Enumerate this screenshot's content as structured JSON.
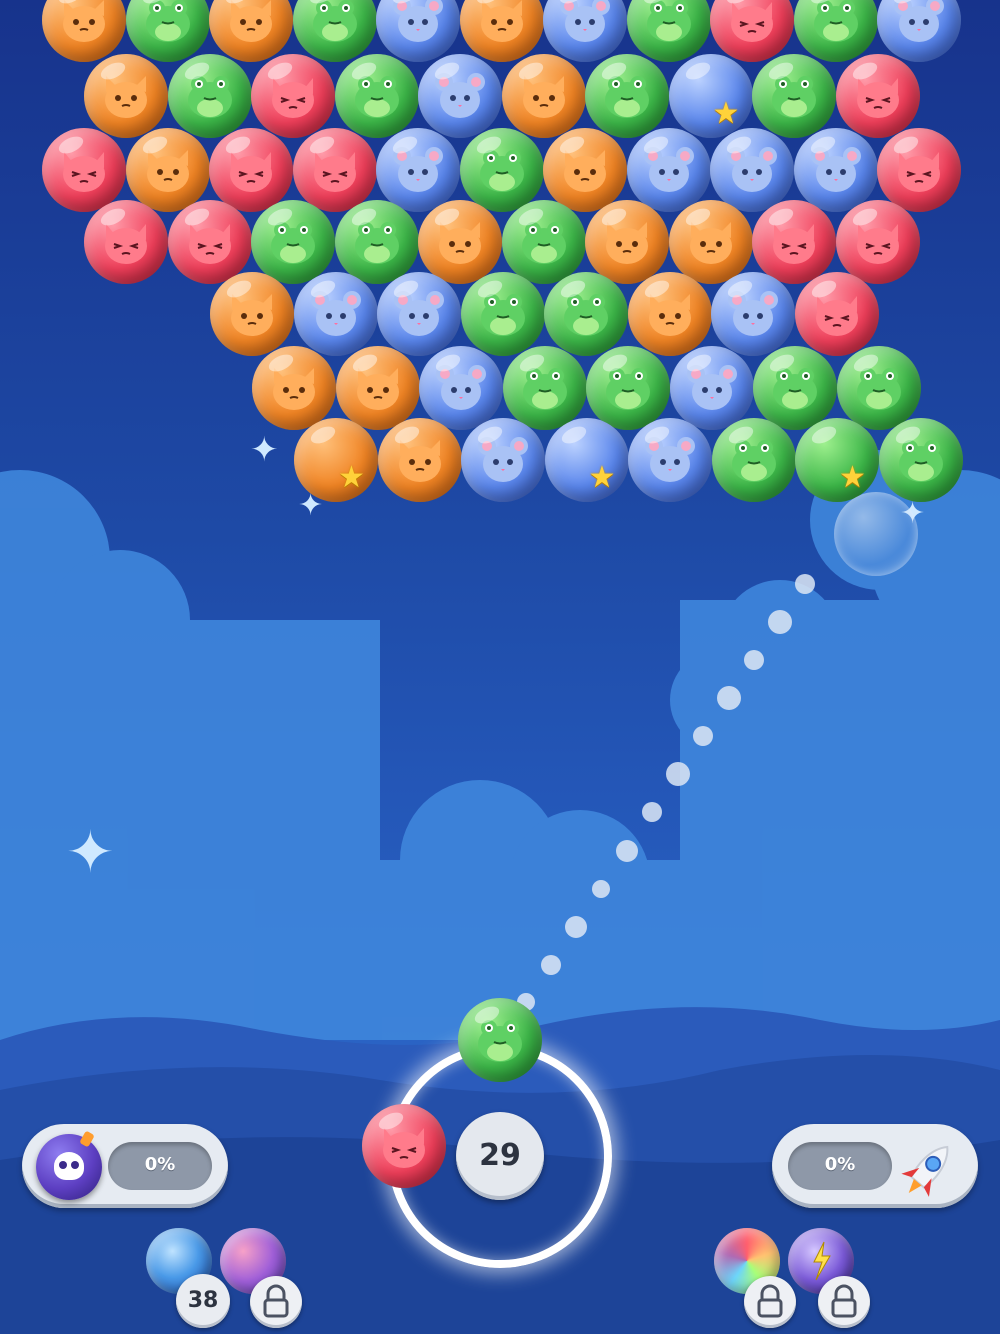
{
  "game": {
    "colors": {
      "orange": "#f4892a",
      "green": "#3cb648",
      "blue": "#5a86ec",
      "red": "#ef3f5a"
    },
    "grid": {
      "animals": {
        "orange": "cat",
        "green": "frog",
        "blue": "mouse",
        "red": "cat-red"
      },
      "rows": [
        [
          "orange",
          "green",
          "orange",
          "green",
          "blue",
          "orange",
          "blue",
          "green",
          "red",
          "green",
          "blue"
        ],
        [
          "orange",
          "green",
          "red",
          "green",
          "blue",
          "orange",
          "green",
          "blue-star",
          "green",
          "red"
        ],
        [
          "red",
          "orange",
          "red",
          "red",
          "blue",
          "green",
          "orange",
          "blue",
          "blue",
          "blue",
          "red"
        ],
        [
          "red",
          "red",
          "green",
          "green",
          "orange",
          "green",
          "orange",
          "orange",
          "red",
          "red"
        ],
        [
          "orange",
          "blue",
          "blue",
          "green",
          "green",
          "orange",
          "blue",
          "red"
        ],
        [
          "orange",
          "orange",
          "blue",
          "green",
          "green",
          "blue",
          "green",
          "green"
        ],
        [
          "orange-star",
          "orange",
          "blue",
          "blue-star",
          "blue",
          "green",
          "green-star",
          "green"
        ]
      ]
    },
    "shooter": {
      "current_bubble": "green",
      "next_bubble": "red",
      "shots_left": "29"
    },
    "left_meter": {
      "icon": "skull-bomb-icon",
      "percent": "0%"
    },
    "right_meter": {
      "icon": "rocket-icon",
      "percent": "0%"
    },
    "boosters_left": [
      {
        "icon": "swirl-bubble-icon",
        "count": "38",
        "locked": false
      },
      {
        "icon": "multi-bubble-icon",
        "locked": true
      }
    ],
    "boosters_right": [
      {
        "icon": "rainbow-bubble-icon",
        "locked": true
      },
      {
        "icon": "lightning-bubble-icon",
        "locked": true
      }
    ]
  }
}
